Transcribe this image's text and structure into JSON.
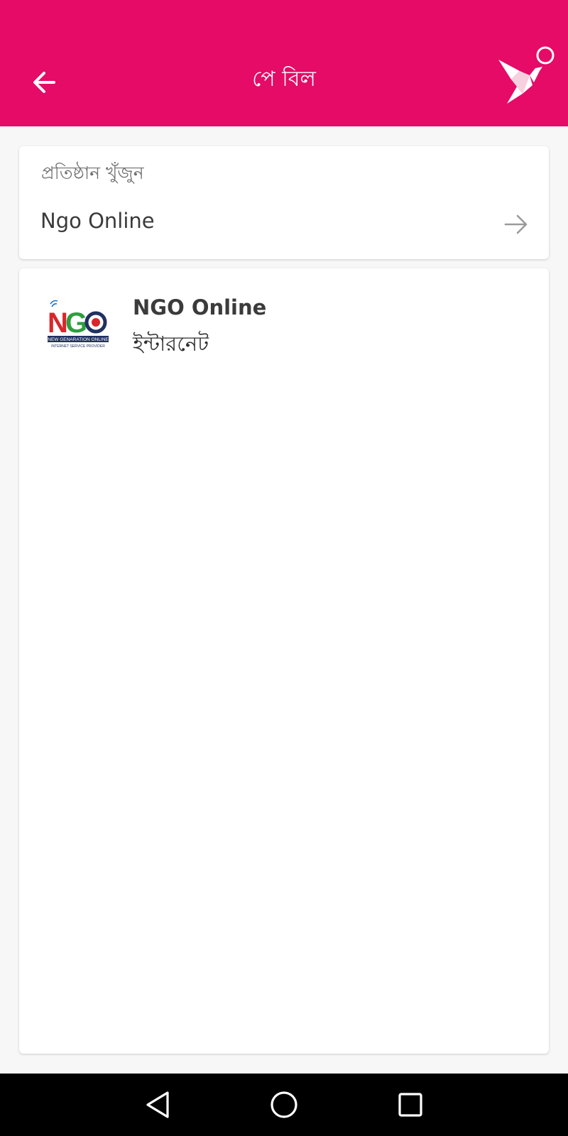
{
  "header": {
    "title": "পে বিল",
    "back_icon": "arrow-left-icon",
    "brand_icon": "origami-bird-icon",
    "background_color": "#e50b67"
  },
  "search": {
    "label": "প্রতিষ্ঠান খুঁজুন",
    "value": "Ngo Online",
    "submit_icon": "arrow-right-icon"
  },
  "results": [
    {
      "name": "NGO Online",
      "category": "ইন্টারনেট",
      "logo": {
        "text": "NGO",
        "tagline": "NEW GENARATION ONLINE",
        "subtagline": "INTERNET SERVICE PROVIDER"
      }
    }
  ],
  "system_nav": {
    "back_icon": "triangle-back-icon",
    "home_icon": "circle-home-icon",
    "recents_icon": "square-recents-icon"
  }
}
